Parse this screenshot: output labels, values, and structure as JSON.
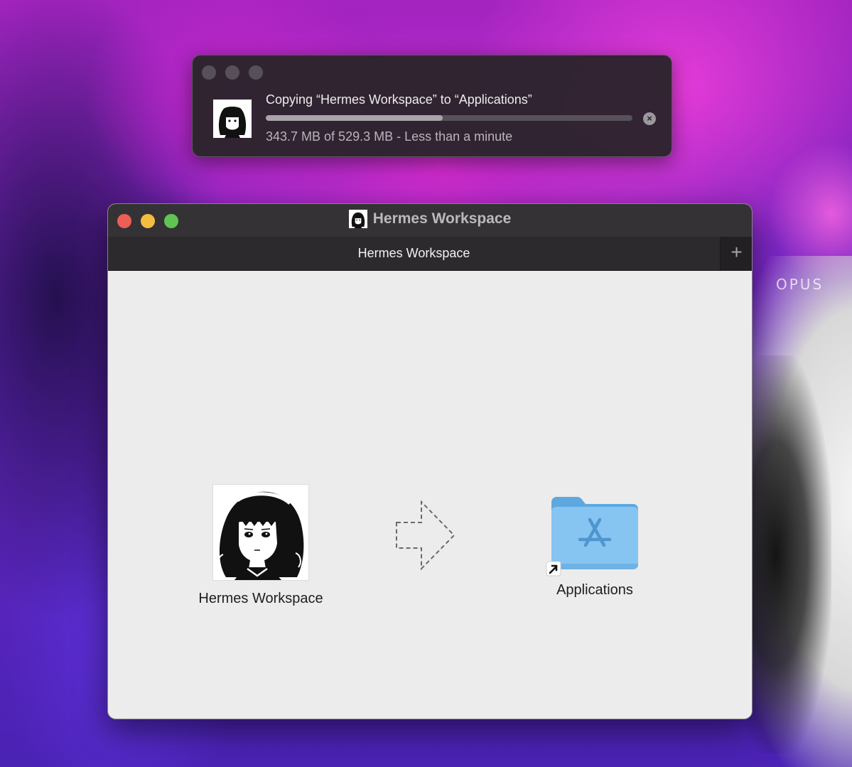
{
  "desktop": {
    "watermark_text": "OPUS"
  },
  "copy_dialog": {
    "title": "Copying “Hermes Workspace” to “Applications”",
    "progress": {
      "fraction": 0.4826
    },
    "status": "343.7 MB of 529.3 MB - Less than a minute",
    "cancel_icon": "x-circle-icon"
  },
  "dmg_window": {
    "title": "Hermes Workspace",
    "tab_label": "Hermes Workspace",
    "new_tab_icon": "plus-icon",
    "items": {
      "app_label": "Hermes Workspace",
      "arrow_icon": "dashed-arrow-right-icon",
      "folder_label": "Applications",
      "folder_icon": "applications-folder-icon",
      "alias_icon": "alias-arrow-icon"
    }
  },
  "colors": {
    "close": "#ee5e56",
    "minimize": "#f4bd40",
    "maximize": "#60c453",
    "folder": "#7dbef0"
  }
}
